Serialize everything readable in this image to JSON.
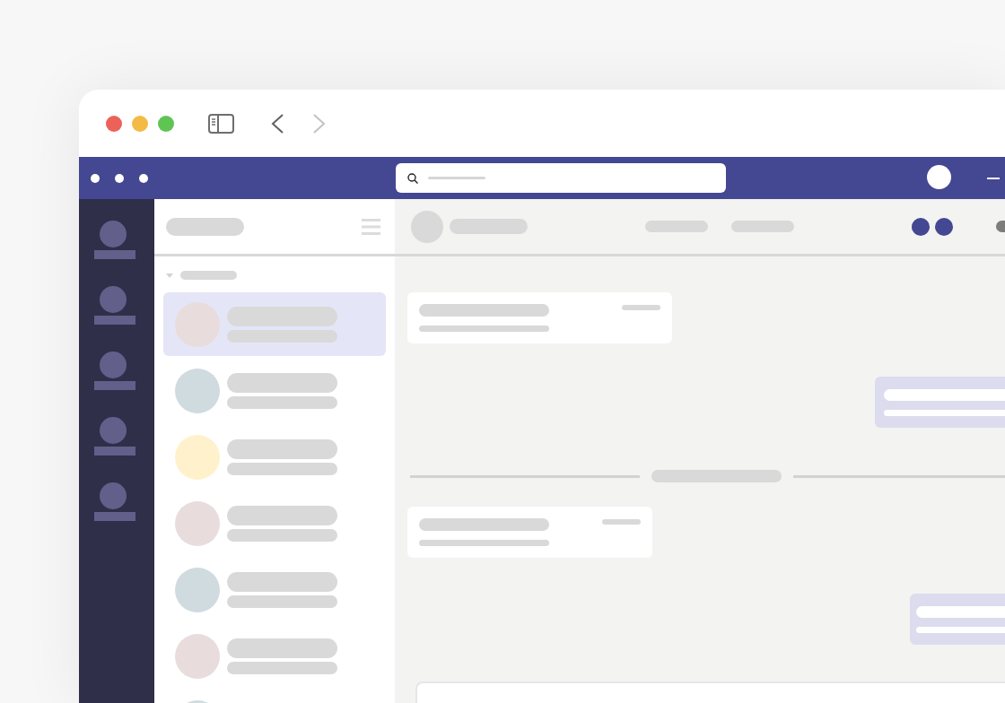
{
  "browser": {
    "traffic_lights": [
      {
        "color": "#ec6159"
      },
      {
        "color": "#f3bb46"
      },
      {
        "color": "#5fc454"
      }
    ]
  },
  "navigation": [
    {
      "kind": "back",
      "disabled": false
    },
    {
      "kind": "forward",
      "disabled": true
    }
  ],
  "chat_list": {
    "section_expanded": true,
    "items": [
      {
        "color": "#e8dcdc",
        "selected": true
      },
      {
        "color": "#d0dbe0",
        "selected": false
      },
      {
        "color": "#fff1cc",
        "selected": false
      },
      {
        "color": "#e8dcdc",
        "selected": false
      },
      {
        "color": "#d0dbe0",
        "selected": false
      },
      {
        "color": "#e8dcdc",
        "selected": false
      },
      {
        "color": "#d0dbe0",
        "selected": false
      }
    ]
  },
  "messages": [
    {
      "kind": "incoming"
    },
    {
      "kind": "outgoing"
    },
    {
      "kind": "divider"
    },
    {
      "kind": "incoming"
    },
    {
      "kind": "outgoing"
    }
  ]
}
